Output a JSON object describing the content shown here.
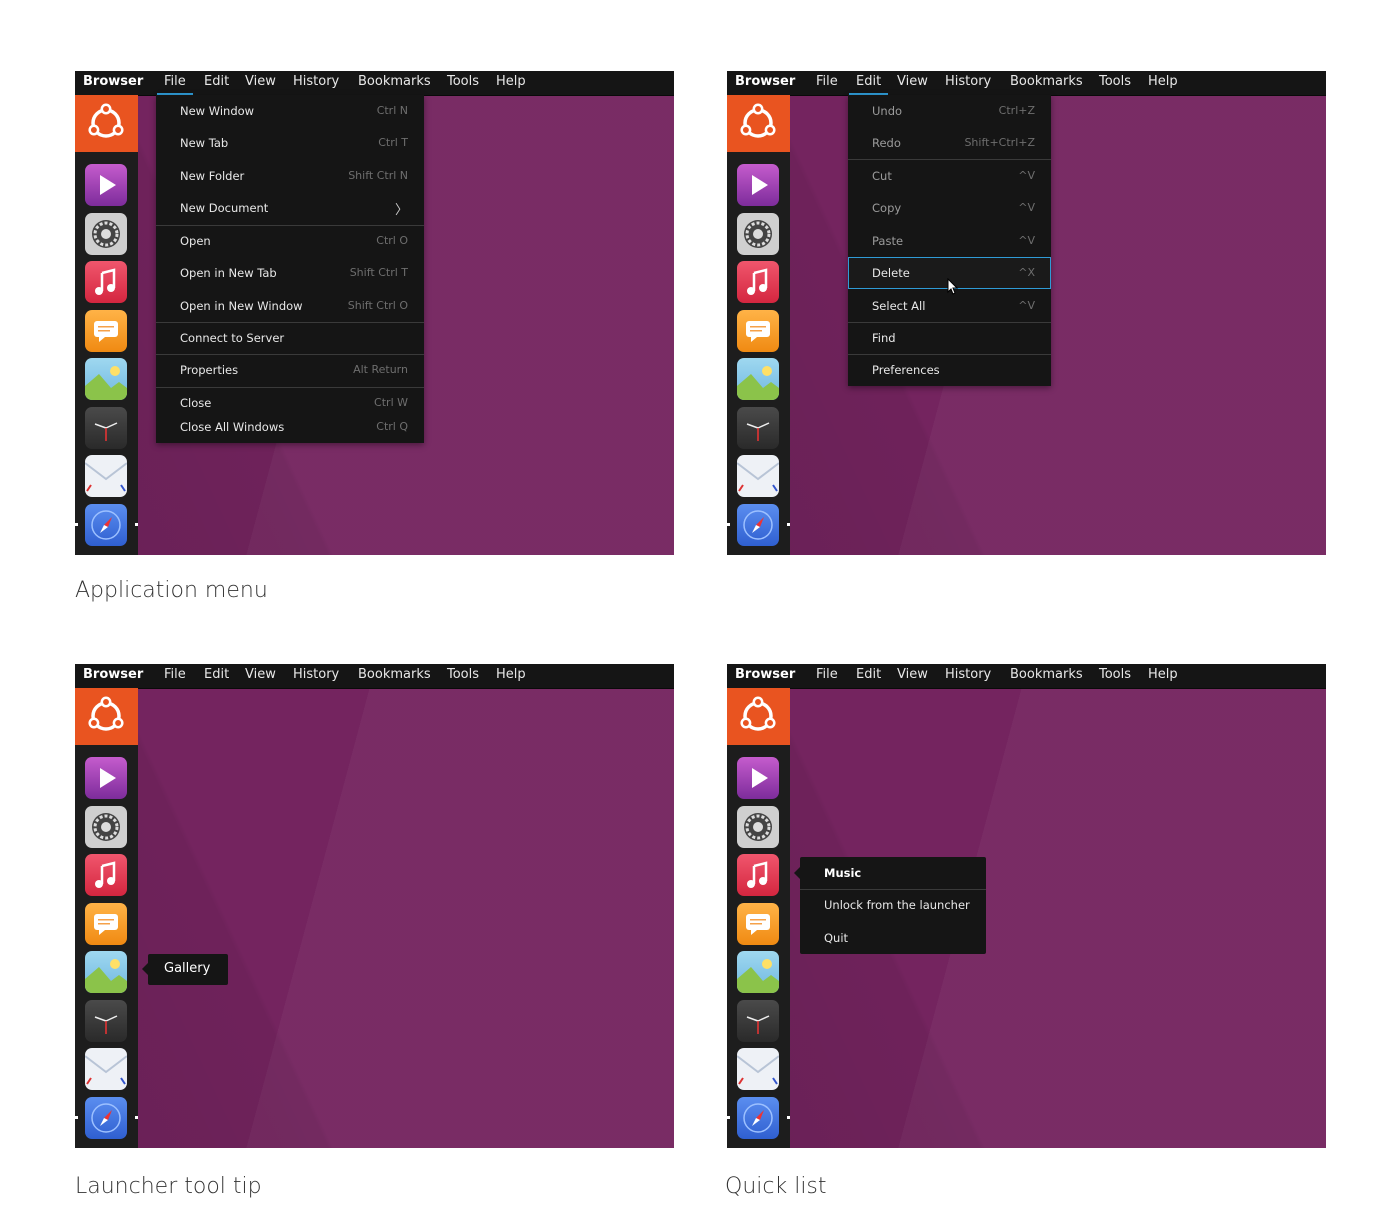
{
  "menubar": {
    "app_title": "Browser",
    "items": [
      "File",
      "Edit",
      "View",
      "History",
      "Bookmarks",
      "Tools",
      "Help"
    ]
  },
  "launcher": {
    "icons": [
      "ubuntu-logo-icon",
      "video-icon",
      "settings-icon",
      "music-icon",
      "messages-icon",
      "gallery-icon",
      "clock-icon",
      "mail-icon",
      "browser-icon"
    ]
  },
  "file_menu": {
    "items": [
      {
        "label": "New Window",
        "shortcut": "Ctrl  N"
      },
      {
        "label": "New Tab",
        "shortcut": "Ctrl  T"
      },
      {
        "label": "New Folder",
        "shortcut": "Shift  Ctrl  N"
      },
      {
        "label": "New Document",
        "shortcut": "〉"
      },
      {
        "label": "Open",
        "shortcut": "Ctrl  O"
      },
      {
        "label": "Open in New Tab",
        "shortcut": "Shift  Ctrl  T"
      },
      {
        "label": "Open in New Window",
        "shortcut": "Shift  Ctrl  O"
      },
      {
        "label": "Connect to Server",
        "shortcut": ""
      },
      {
        "label": "Properties",
        "shortcut": "Alt  Return"
      },
      {
        "label": "Close",
        "shortcut": "Ctrl  W"
      },
      {
        "label": "Close All Windows",
        "shortcut": "Ctrl  Q"
      }
    ]
  },
  "edit_menu": {
    "items": [
      {
        "label": "Undo",
        "shortcut": "Ctrl+Z"
      },
      {
        "label": "Redo",
        "shortcut": "Shift+Ctrl+Z"
      },
      {
        "label": "Cut",
        "shortcut": "^V"
      },
      {
        "label": "Copy",
        "shortcut": "^V"
      },
      {
        "label": "Paste",
        "shortcut": "^V"
      },
      {
        "label": "Delete",
        "shortcut": "^X"
      },
      {
        "label": "Select All",
        "shortcut": "^V"
      },
      {
        "label": "Find",
        "shortcut": ""
      },
      {
        "label": "Preferences",
        "shortcut": ""
      }
    ]
  },
  "tooltip": {
    "label": "Gallery"
  },
  "quicklist": {
    "title": "Music",
    "items": [
      "Unlock from the launcher",
      "Quit"
    ]
  },
  "captions": {
    "application_menu": "Application menu",
    "launcher_tooltip": "Launcher tool tip",
    "quick_list": "Quick list"
  },
  "colors": {
    "desktop": "#74245f",
    "menubar": "#151515",
    "launcher": "#1d1d1d",
    "ubuntu_orange": "#e95420",
    "highlight": "#2f9bd6"
  }
}
